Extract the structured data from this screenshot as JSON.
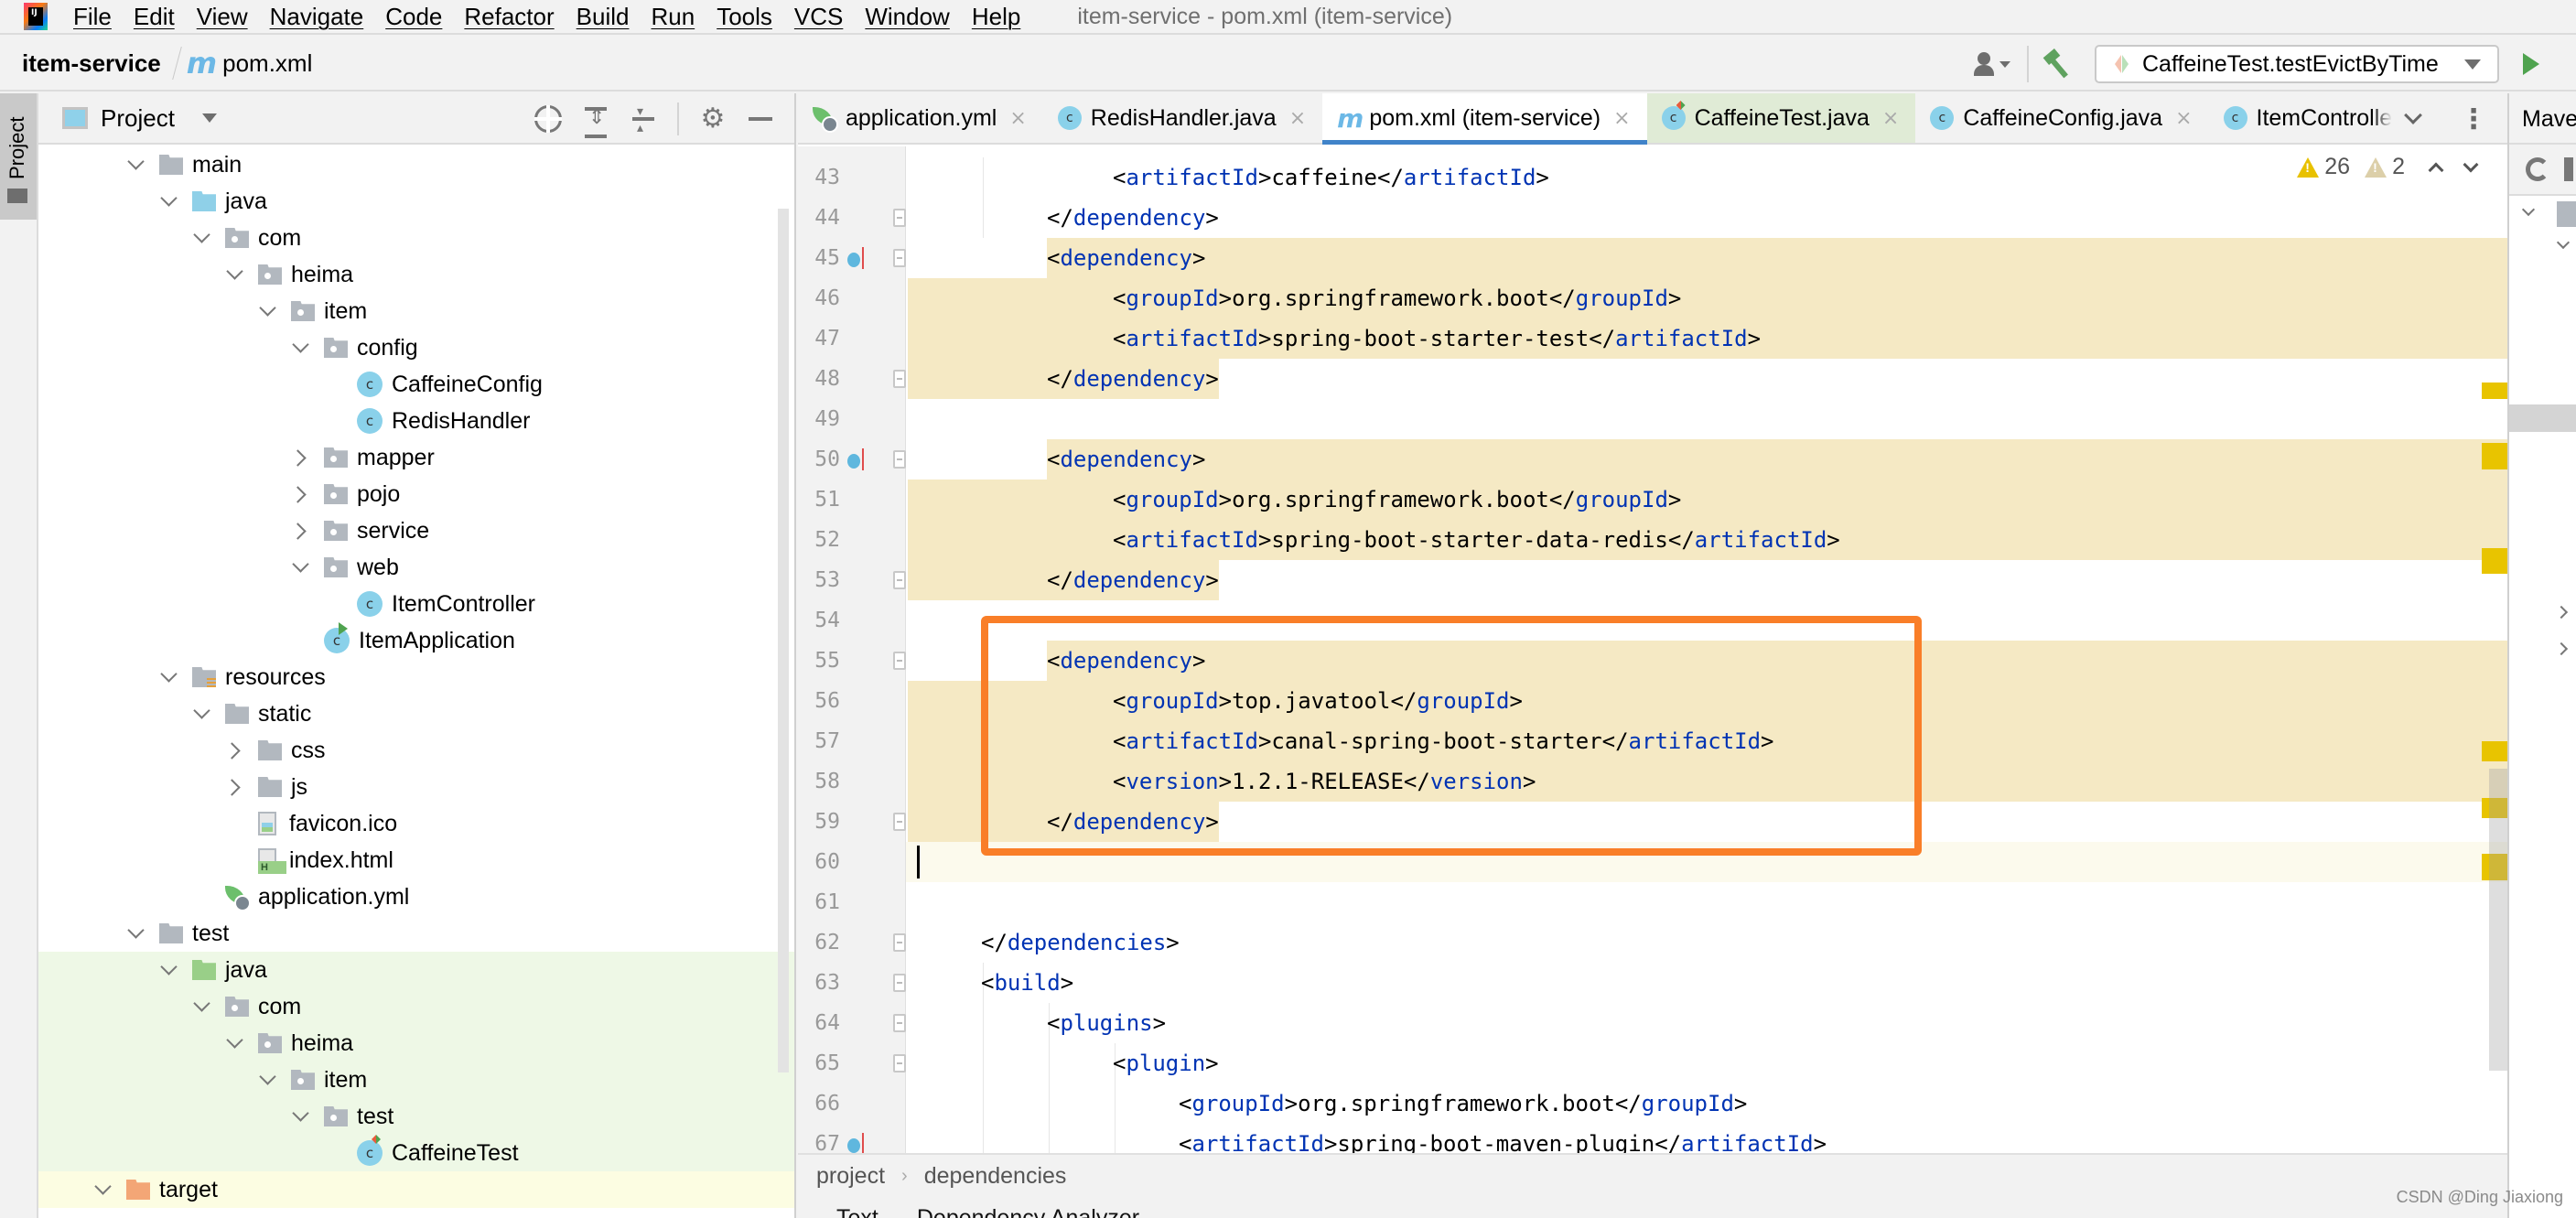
{
  "menu": {
    "items": [
      "File",
      "Edit",
      "View",
      "Navigate",
      "Code",
      "Refactor",
      "Build",
      "Run",
      "Tools",
      "VCS",
      "Window",
      "Help"
    ],
    "window_title": "item-service - pom.xml (item-service)"
  },
  "navbar": {
    "project": "item-service",
    "file": "pom.xml",
    "run_config": "CaffeineTest.testEvictByTime"
  },
  "left_stripe": {
    "project_label": "Project"
  },
  "project_panel": {
    "view_label": "Project",
    "tree": [
      {
        "label": "main",
        "depth": 0,
        "arrow": "down",
        "icon": "folder"
      },
      {
        "label": "java",
        "depth": 1,
        "arrow": "down",
        "icon": "folder-src"
      },
      {
        "label": "com",
        "depth": 2,
        "arrow": "down",
        "icon": "package"
      },
      {
        "label": "heima",
        "depth": 3,
        "arrow": "down",
        "icon": "package"
      },
      {
        "label": "item",
        "depth": 4,
        "arrow": "down",
        "icon": "package"
      },
      {
        "label": "config",
        "depth": 5,
        "arrow": "down",
        "icon": "package"
      },
      {
        "label": "CaffeineConfig",
        "depth": 6,
        "arrow": "none",
        "icon": "class"
      },
      {
        "label": "RedisHandler",
        "depth": 6,
        "arrow": "none",
        "icon": "class"
      },
      {
        "label": "mapper",
        "depth": 5,
        "arrow": "right",
        "icon": "package"
      },
      {
        "label": "pojo",
        "depth": 5,
        "arrow": "right",
        "icon": "package"
      },
      {
        "label": "service",
        "depth": 5,
        "arrow": "right",
        "icon": "package"
      },
      {
        "label": "web",
        "depth": 5,
        "arrow": "down",
        "icon": "package"
      },
      {
        "label": "ItemController",
        "depth": 6,
        "arrow": "none",
        "icon": "class"
      },
      {
        "label": "ItemApplication",
        "depth": 5,
        "arrow": "none",
        "icon": "class-app"
      },
      {
        "label": "resources",
        "depth": 1,
        "arrow": "down",
        "icon": "folder-res"
      },
      {
        "label": "static",
        "depth": 2,
        "arrow": "down",
        "icon": "folder"
      },
      {
        "label": "css",
        "depth": 3,
        "arrow": "right",
        "icon": "folder"
      },
      {
        "label": "js",
        "depth": 3,
        "arrow": "right",
        "icon": "folder"
      },
      {
        "label": "favicon.ico",
        "depth": 3,
        "arrow": "none",
        "icon": "file-image"
      },
      {
        "label": "index.html",
        "depth": 3,
        "arrow": "none",
        "icon": "file-html"
      },
      {
        "label": "application.yml",
        "depth": 2,
        "arrow": "none",
        "icon": "spring-yml"
      },
      {
        "label": "test",
        "depth": 0,
        "arrow": "down",
        "icon": "folder"
      },
      {
        "label": "java",
        "depth": 1,
        "arrow": "down",
        "icon": "folder-test",
        "bg": "test"
      },
      {
        "label": "com",
        "depth": 2,
        "arrow": "down",
        "icon": "package",
        "bg": "test"
      },
      {
        "label": "heima",
        "depth": 3,
        "arrow": "down",
        "icon": "package",
        "bg": "test"
      },
      {
        "label": "item",
        "depth": 4,
        "arrow": "down",
        "icon": "package",
        "bg": "test"
      },
      {
        "label": "test",
        "depth": 5,
        "arrow": "down",
        "icon": "package",
        "bg": "test"
      },
      {
        "label": "CaffeineTest",
        "depth": 6,
        "arrow": "none",
        "icon": "class-test",
        "bg": "test"
      },
      {
        "label": "target",
        "depth": -1,
        "arrow": "down",
        "icon": "folder-excluded",
        "bg": "target"
      }
    ]
  },
  "editor": {
    "tabs": [
      {
        "label": "application.yml",
        "icon": "spring-yml",
        "closable": true
      },
      {
        "label": "RedisHandler.java",
        "icon": "class",
        "closable": true
      },
      {
        "label": "pom.xml (item-service)",
        "icon": "maven",
        "closable": true,
        "active": true
      },
      {
        "label": "CaffeineTest.java",
        "icon": "class-test",
        "closable": true,
        "modified_bg": true
      },
      {
        "label": "CaffeineConfig.java",
        "icon": "class",
        "closable": true
      },
      {
        "label": "ItemControlle",
        "icon": "class",
        "closable": false
      }
    ],
    "warnings": {
      "count": "26",
      "weak_count": "2"
    },
    "lines": [
      {
        "n": "43",
        "indent": 2,
        "parts": [
          [
            "p",
            "<"
          ],
          [
            "t",
            "artifactId"
          ],
          [
            "p",
            ">"
          ],
          [
            "x",
            "caffeine"
          ],
          [
            "p",
            "</"
          ],
          [
            "t",
            "artifactId"
          ],
          [
            "p",
            ">"
          ]
        ]
      },
      {
        "n": "44",
        "indent": 1,
        "fold": true,
        "parts": [
          [
            "p",
            "</"
          ],
          [
            "t",
            "dependency"
          ],
          [
            "p",
            ">"
          ]
        ]
      },
      {
        "n": "45",
        "indent": 1,
        "fold": true,
        "override": true,
        "hl": "tag",
        "parts": [
          [
            "p",
            "<"
          ],
          [
            "t",
            "dependency"
          ],
          [
            "p",
            ">"
          ]
        ]
      },
      {
        "n": "46",
        "indent": 2,
        "hl": "full",
        "parts": [
          [
            "p",
            "<"
          ],
          [
            "t",
            "groupId"
          ],
          [
            "p",
            ">"
          ],
          [
            "x",
            "org.springframework.boot"
          ],
          [
            "p",
            "</"
          ],
          [
            "t",
            "groupId"
          ],
          [
            "p",
            ">"
          ]
        ]
      },
      {
        "n": "47",
        "indent": 2,
        "hl": "full",
        "parts": [
          [
            "p",
            "<"
          ],
          [
            "t",
            "artifactId"
          ],
          [
            "p",
            ">"
          ],
          [
            "x",
            "spring-boot-starter-test"
          ],
          [
            "p",
            "</"
          ],
          [
            "t",
            "artifactId"
          ],
          [
            "p",
            ">"
          ]
        ]
      },
      {
        "n": "48",
        "indent": 1,
        "fold": true,
        "hl": "end",
        "parts": [
          [
            "p",
            "</"
          ],
          [
            "t",
            "dependency"
          ],
          [
            "p",
            ">"
          ]
        ]
      },
      {
        "n": "49",
        "indent": 0,
        "parts": []
      },
      {
        "n": "50",
        "indent": 1,
        "fold": true,
        "override": true,
        "hl": "tag",
        "parts": [
          [
            "p",
            "<"
          ],
          [
            "t",
            "dependency"
          ],
          [
            "p",
            ">"
          ]
        ]
      },
      {
        "n": "51",
        "indent": 2,
        "hl": "full",
        "parts": [
          [
            "p",
            "<"
          ],
          [
            "t",
            "groupId"
          ],
          [
            "p",
            ">"
          ],
          [
            "x",
            "org.springframework.boot"
          ],
          [
            "p",
            "</"
          ],
          [
            "t",
            "groupId"
          ],
          [
            "p",
            ">"
          ]
        ]
      },
      {
        "n": "52",
        "indent": 2,
        "hl": "full",
        "parts": [
          [
            "p",
            "<"
          ],
          [
            "t",
            "artifactId"
          ],
          [
            "p",
            ">"
          ],
          [
            "x",
            "spring-boot-starter-data-redis"
          ],
          [
            "p",
            "</"
          ],
          [
            "t",
            "artifactId"
          ],
          [
            "p",
            ">"
          ]
        ]
      },
      {
        "n": "53",
        "indent": 1,
        "fold": true,
        "hl": "end",
        "parts": [
          [
            "p",
            "</"
          ],
          [
            "t",
            "dependency"
          ],
          [
            "p",
            ">"
          ]
        ]
      },
      {
        "n": "54",
        "indent": 0,
        "parts": []
      },
      {
        "n": "55",
        "indent": 1,
        "fold": true,
        "hl": "tag",
        "parts": [
          [
            "p",
            "<"
          ],
          [
            "t",
            "dependency"
          ],
          [
            "p",
            ">"
          ]
        ]
      },
      {
        "n": "56",
        "indent": 2,
        "hl": "full",
        "parts": [
          [
            "p",
            "<"
          ],
          [
            "t",
            "groupId"
          ],
          [
            "p",
            ">"
          ],
          [
            "x",
            "top.javatool"
          ],
          [
            "p",
            "</"
          ],
          [
            "t",
            "groupId"
          ],
          [
            "p",
            ">"
          ]
        ]
      },
      {
        "n": "57",
        "indent": 2,
        "hl": "full",
        "parts": [
          [
            "p",
            "<"
          ],
          [
            "t",
            "artifactId"
          ],
          [
            "p",
            ">"
          ],
          [
            "x",
            "canal-spring-boot-starter"
          ],
          [
            "p",
            "</"
          ],
          [
            "t",
            "artifactId"
          ],
          [
            "p",
            ">"
          ]
        ]
      },
      {
        "n": "58",
        "indent": 2,
        "hl": "full",
        "parts": [
          [
            "p",
            "<"
          ],
          [
            "t",
            "version"
          ],
          [
            "p",
            ">"
          ],
          [
            "x",
            "1.2.1-RELEASE"
          ],
          [
            "p",
            "</"
          ],
          [
            "t",
            "version"
          ],
          [
            "p",
            ">"
          ]
        ]
      },
      {
        "n": "59",
        "indent": 1,
        "fold": true,
        "hl": "end",
        "parts": [
          [
            "p",
            "</"
          ],
          [
            "t",
            "dependency"
          ],
          [
            "p",
            ">"
          ]
        ]
      },
      {
        "n": "60",
        "indent": 0,
        "current": true,
        "parts": []
      },
      {
        "n": "61",
        "indent": 0,
        "parts": []
      },
      {
        "n": "62",
        "indent": 0,
        "fold": true,
        "parts": [
          [
            "p",
            "</"
          ],
          [
            "t",
            "dependencies"
          ],
          [
            "p",
            ">"
          ]
        ]
      },
      {
        "n": "63",
        "indent": 0,
        "fold": true,
        "parts": [
          [
            "p",
            "<"
          ],
          [
            "t",
            "build"
          ],
          [
            "p",
            ">"
          ]
        ]
      },
      {
        "n": "64",
        "indent": 1,
        "fold": true,
        "parts": [
          [
            "p",
            "<"
          ],
          [
            "t",
            "plugins"
          ],
          [
            "p",
            ">"
          ]
        ]
      },
      {
        "n": "65",
        "indent": 2,
        "fold": true,
        "parts": [
          [
            "p",
            "<"
          ],
          [
            "t",
            "plugin"
          ],
          [
            "p",
            ">"
          ]
        ]
      },
      {
        "n": "66",
        "indent": 3,
        "parts": [
          [
            "p",
            "<"
          ],
          [
            "t",
            "groupId"
          ],
          [
            "p",
            ">"
          ],
          [
            "x",
            "org.springframework.boot"
          ],
          [
            "p",
            "</"
          ],
          [
            "t",
            "groupId"
          ],
          [
            "p",
            ">"
          ]
        ]
      },
      {
        "n": "67",
        "indent": 3,
        "override": true,
        "parts": [
          [
            "p",
            "<"
          ],
          [
            "t",
            "artifactId"
          ],
          [
            "p",
            ">"
          ],
          [
            "x",
            "spring-boot-maven-plugin"
          ],
          [
            "p",
            "</"
          ],
          [
            "t",
            "artifactId"
          ],
          [
            "p",
            ">"
          ]
        ]
      }
    ],
    "breadcrumb": [
      "project",
      "dependencies"
    ],
    "bottom_tabs": [
      "Text",
      "Dependency Analyzer"
    ]
  },
  "maven_panel": {
    "title": "Maven"
  },
  "watermark": "CSDN @Ding Jiaxiong",
  "colors": {
    "xml_tag": "#0033b3",
    "highlight_bg": "#f5e9c4",
    "annotation_box": "#f97e28",
    "active_tab_underline": "#4083c9",
    "warning": "#e8c100"
  }
}
